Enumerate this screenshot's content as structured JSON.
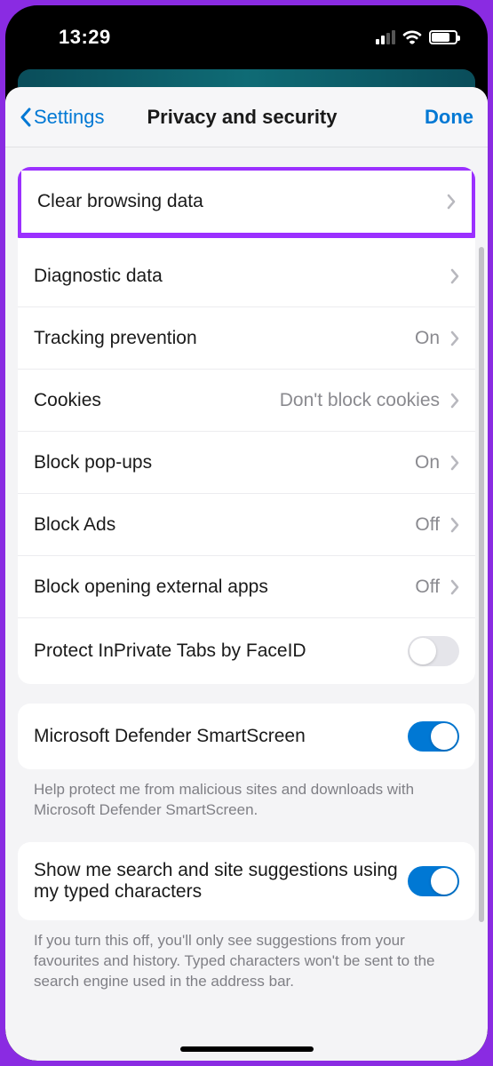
{
  "status": {
    "time": "13:29"
  },
  "nav": {
    "back_label": "Settings",
    "title": "Privacy and security",
    "done_label": "Done"
  },
  "rows": {
    "clear_browsing": {
      "label": "Clear browsing data"
    },
    "diagnostic": {
      "label": "Diagnostic data"
    },
    "tracking": {
      "label": "Tracking prevention",
      "value": "On"
    },
    "cookies": {
      "label": "Cookies",
      "value": "Don't block cookies"
    },
    "popups": {
      "label": "Block pop-ups",
      "value": "On"
    },
    "ads": {
      "label": "Block Ads",
      "value": "Off"
    },
    "external_apps": {
      "label": "Block opening external apps",
      "value": "Off"
    },
    "protect_inprivate": {
      "label": "Protect InPrivate Tabs by FaceID",
      "toggle": false
    },
    "smartscreen": {
      "label": "Microsoft Defender SmartScreen",
      "toggle": true
    },
    "search_suggest": {
      "label": "Show me search and site suggestions using my typed characters",
      "toggle": true
    }
  },
  "footers": {
    "smartscreen": "Help protect me from malicious sites and downloads with Microsoft Defender SmartScreen.",
    "search_suggest": "If you turn this off, you'll only see suggestions from your favourites and history. Typed characters won't be sent to the search engine used in the address bar."
  }
}
